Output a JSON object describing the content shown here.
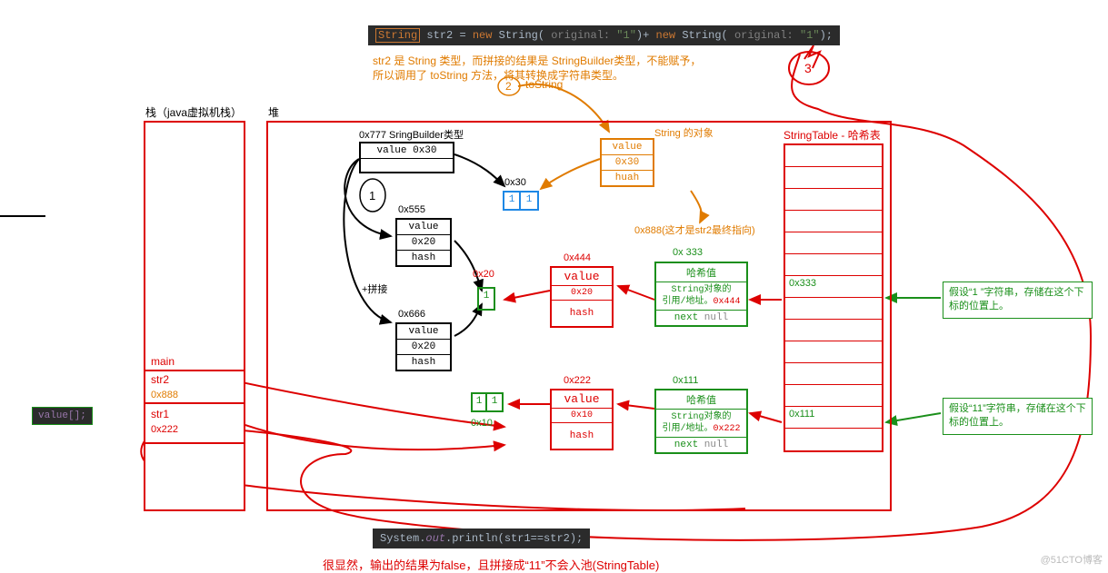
{
  "code_top": {
    "kw": "String",
    "rest_html": " str2 = new String( original: \"1\")+ new String( original: \"1\");"
  },
  "explain_top1": "str2 是 String 类型，而拼接的结果是 StringBuilder类型，不能赋予，",
  "explain_top2": "所以调用了 toString 方法，将其转换成字符串类型。",
  "tostring_label": "toString",
  "stack": {
    "title": "栈（java虚拟机栈）",
    "main": "main",
    "str2": "str2",
    "addr2": "0x888",
    "str1": "str1",
    "addr1": "0x222"
  },
  "value_badge": "value[];",
  "heap_title": "堆",
  "sb": {
    "title": "0x777 SringBuilder类型",
    "row": "value 0x30"
  },
  "arr30": {
    "addr": "0x30",
    "c1": "1",
    "c2": "1"
  },
  "string_obj": {
    "title": "String 的对象",
    "row1": "value",
    "row2": "0x30",
    "row3": "huah"
  },
  "addr888_label": "0x888(这才是str2最终指向)",
  "obj555": {
    "addr": "0x555",
    "r1": "value",
    "r2": "0x20",
    "r3": "hash"
  },
  "concat": "+拼接",
  "obj666": {
    "addr": "0x666",
    "r1": "value",
    "r2": "0x20",
    "r3": "hash"
  },
  "arr20": {
    "addr": "0x20",
    "c1": "1"
  },
  "arr10": {
    "addr": "0x10",
    "c1": "1",
    "c2": "1"
  },
  "obj444": {
    "addr": "0x444",
    "r1": "value",
    "r2": "0x20",
    "r3": "hash"
  },
  "obj222": {
    "addr": "0x222",
    "r1": "value",
    "r2": "0x10",
    "r3": "hash"
  },
  "node333": {
    "addr": "0x 333",
    "r1": "哈希值",
    "r2a": "String对象的",
    "r2b": "引用/地址。",
    "r2c": "0x444",
    "r3a": "next",
    "r3b": "null"
  },
  "node111": {
    "addr": "0x111",
    "r1": "哈希值",
    "r2a": "String对象的",
    "r2b": "引用/地址。",
    "r2c": "0x222",
    "r3a": "next",
    "r3b": "null"
  },
  "string_table": {
    "title": "StringTable - 哈希表",
    "slot333": "0x333",
    "slot111": "0x111"
  },
  "note1": "假设“1 ”字符串，存储在这个下标的位置上。",
  "note2": "假设“11”字符串，存储在这个下标的位置上。",
  "code_bottom": "System.out.println(str1==str2);",
  "conclusion": "很显然，输出的结果为false，且拼接成“11”不会入池(StringTable)",
  "watermark": "@51CTO博客"
}
